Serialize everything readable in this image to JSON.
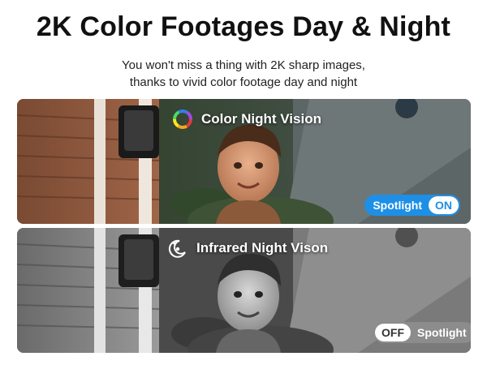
{
  "header": {
    "title": "2K Color Footages Day & Night",
    "subtitle_line1": "You won't miss a thing with 2K sharp images,",
    "subtitle_line2": "thanks to vivid color footage day and night"
  },
  "panels": [
    {
      "title": "Color Night Vision",
      "icon": "color-wheel-icon",
      "toggle_label": "Spotlight",
      "toggle_state": "ON"
    },
    {
      "title": "Infrared Night Vison",
      "icon": "infrared-moon-icon",
      "toggle_label": "Spotlight",
      "toggle_state": "OFF"
    }
  ],
  "colors": {
    "accent_blue": "#1e8fe6",
    "toggle_off_gray": "#8c8c8c"
  }
}
